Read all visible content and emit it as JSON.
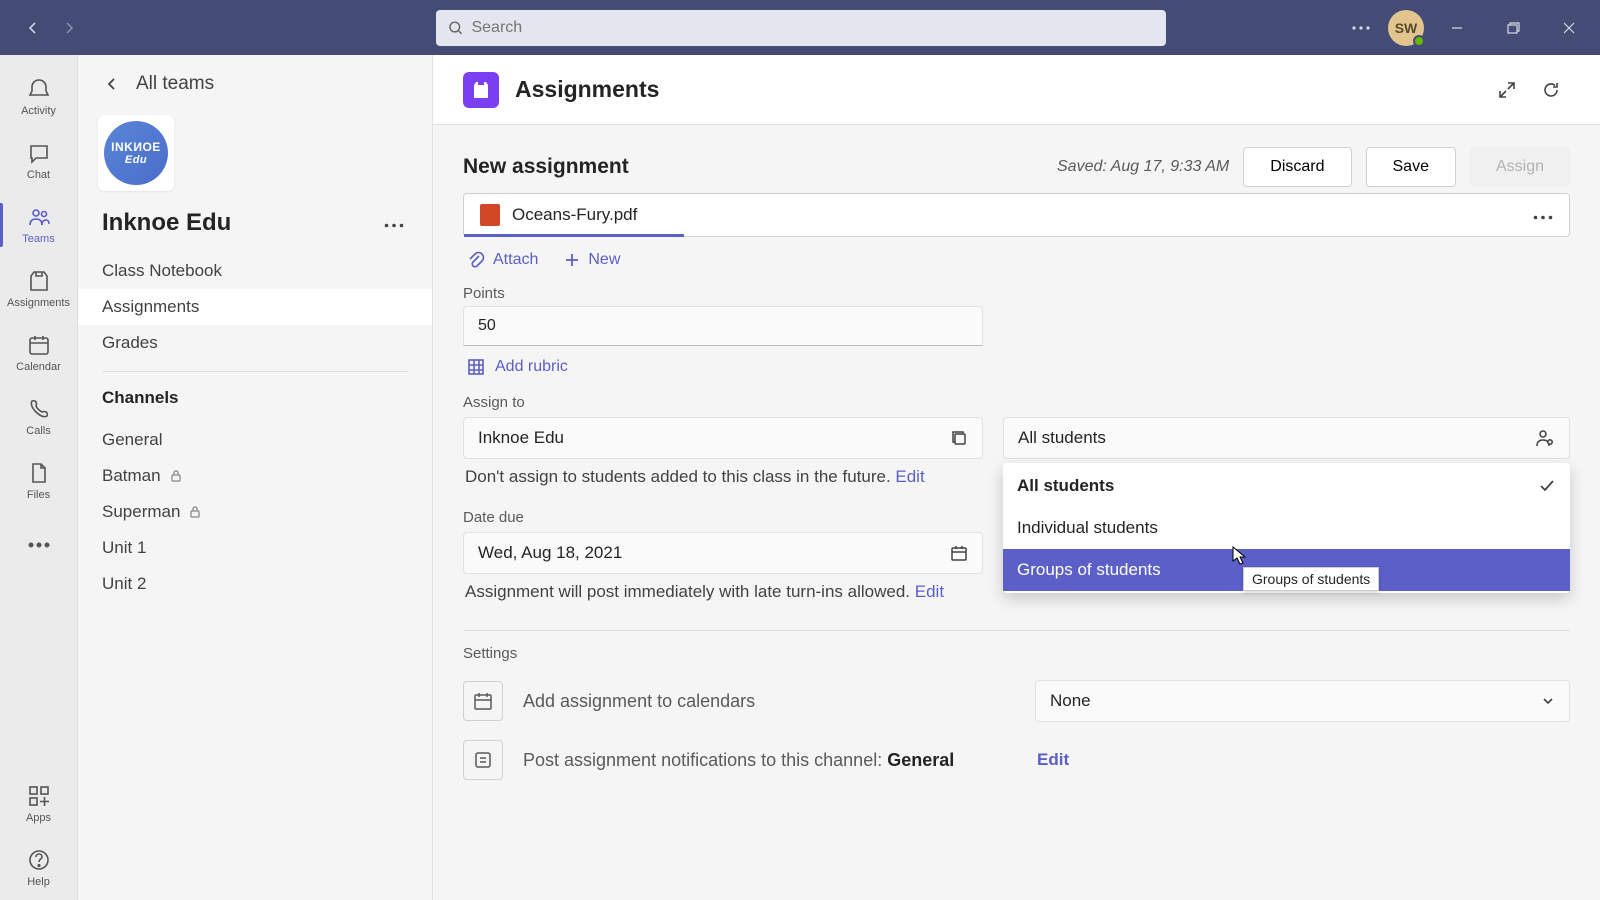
{
  "titlebar": {
    "search_placeholder": "Search",
    "avatar_initials": "SW"
  },
  "apprail": {
    "activity": "Activity",
    "chat": "Chat",
    "teams": "Teams",
    "assignments": "Assignments",
    "calendar": "Calendar",
    "calls": "Calls",
    "files": "Files",
    "apps": "Apps",
    "help": "Help"
  },
  "sidebar": {
    "all_teams": "All teams",
    "team_logo_top": "INKИOE",
    "team_logo_bottom": "Edu",
    "team_name": "Inknoe Edu",
    "items": [
      {
        "label": "Class Notebook"
      },
      {
        "label": "Assignments"
      },
      {
        "label": "Grades"
      }
    ],
    "channels_header": "Channels",
    "channels": [
      {
        "label": "General",
        "private": false
      },
      {
        "label": "Batman",
        "private": true
      },
      {
        "label": "Superman",
        "private": true
      },
      {
        "label": "Unit 1",
        "private": false
      },
      {
        "label": "Unit 2",
        "private": false
      }
    ]
  },
  "tabhead": {
    "title": "Assignments"
  },
  "form": {
    "heading": "New assignment",
    "saved_text": "Saved: Aug 17, 9:33 AM",
    "discard": "Discard",
    "save": "Save",
    "assign": "Assign",
    "filename": "Oceans-Fury.pdf",
    "attach": "Attach",
    "new_btn": "New",
    "points_label": "Points",
    "points_value": "50",
    "add_rubric": "Add rubric",
    "assign_to_label": "Assign to",
    "assign_to_class": "Inknoe Edu",
    "assign_to_students": "All students",
    "future_note": "Don't assign to students added to this class in the future. ",
    "edit_link": "Edit",
    "dropdown": {
      "all": "All students",
      "individual": "Individual students",
      "groups": "Groups of students"
    },
    "tooltip": "Groups of students",
    "date_due_label": "Date due",
    "date_due_value": "Wed, Aug 18, 2021",
    "post_note": "Assignment will post immediately with late turn-ins allowed. ",
    "settings_label": "Settings",
    "calendar_row": "Add assignment to calendars",
    "calendar_value": "None",
    "channel_row_pre": "Post assignment notifications to this channel: ",
    "channel_row_bold": "General"
  }
}
